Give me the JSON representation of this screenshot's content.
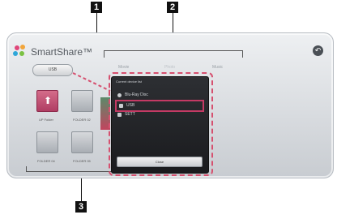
{
  "markers": [
    "1",
    "2",
    "3"
  ],
  "app": {
    "title": "SmartShare™",
    "logo_icon": "smartshare-logo-icon"
  },
  "source": {
    "label": "USB"
  },
  "tabs": [
    {
      "label": "Movie"
    },
    {
      "label": "Photo"
    },
    {
      "label": "Music"
    }
  ],
  "back": {
    "icon": "back-arrow-icon",
    "glyph": "↶"
  },
  "thumbnails": [
    {
      "label": "UP Folder",
      "icon": "up-arrow-icon"
    },
    {
      "label": "FOLDER 02",
      "icon": "folder-icon"
    },
    {
      "label": "FOLDER 04",
      "icon": "folder-icon"
    },
    {
      "label": "FOLDER 05",
      "icon": "folder-icon"
    }
  ],
  "dialog": {
    "title": "Current device list",
    "options": [
      {
        "label": "Blu-Ray Disc",
        "icon": "disc-icon"
      },
      {
        "label": "USB",
        "icon": "usb-icon"
      },
      {
        "label": "SETT",
        "icon": "network-icon"
      }
    ],
    "close_label": "Close"
  },
  "colors": {
    "highlight": "#c43a64",
    "callout": "#d6506f"
  }
}
